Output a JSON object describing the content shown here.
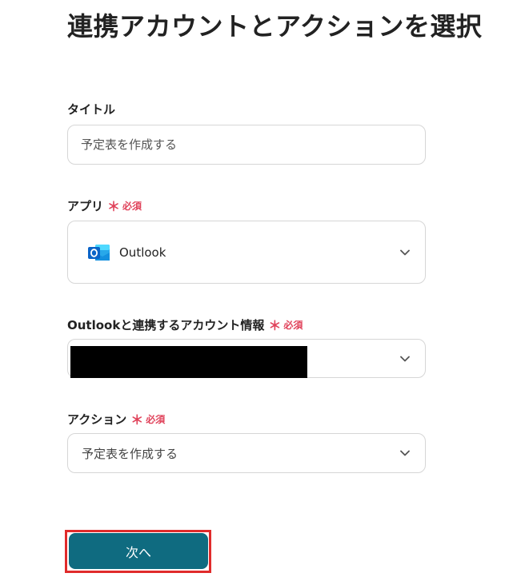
{
  "page": {
    "title": "連携アカウントとアクションを選択"
  },
  "required_mark": "＊",
  "required_text": "必須",
  "title_field": {
    "label": "タイトル",
    "placeholder": "予定表を作成する"
  },
  "app_field": {
    "label": "アプリ",
    "value": "Outlook",
    "icon": "outlook-icon"
  },
  "account_field": {
    "label": "Outlookと連携するアカウント情報",
    "value": ""
  },
  "action_field": {
    "label": "アクション",
    "value": "予定表を作成する"
  },
  "next_button": {
    "label": "次へ"
  },
  "colors": {
    "accent": "#0f6b80",
    "required": "#e0425a",
    "highlight_outline": "#e02b2b",
    "outlook_blue": "#0a64c8"
  }
}
